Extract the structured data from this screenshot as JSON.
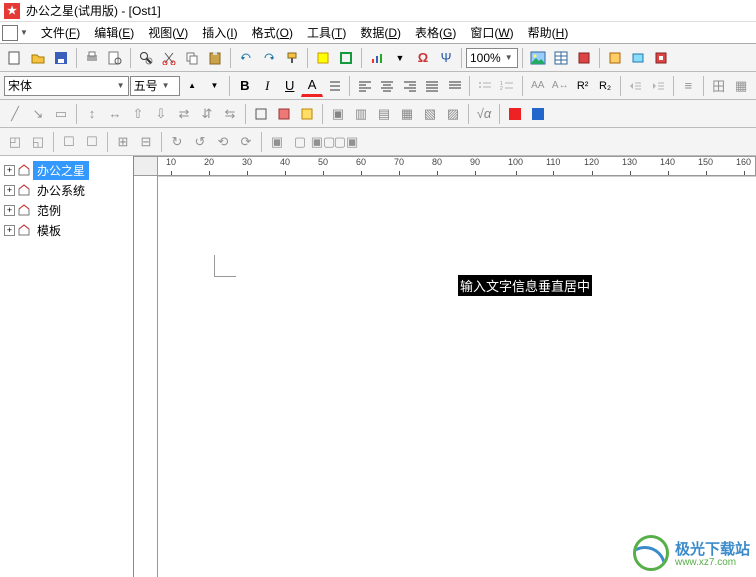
{
  "title": "办公之星(试用版) - [Ost1]",
  "menus": [
    {
      "label": "文件",
      "hotkey": "F"
    },
    {
      "label": "编辑",
      "hotkey": "E"
    },
    {
      "label": "视图",
      "hotkey": "V"
    },
    {
      "label": "插入",
      "hotkey": "I"
    },
    {
      "label": "格式",
      "hotkey": "O"
    },
    {
      "label": "工具",
      "hotkey": "T"
    },
    {
      "label": "数据",
      "hotkey": "D"
    },
    {
      "label": "表格",
      "hotkey": "G"
    },
    {
      "label": "窗口",
      "hotkey": "W"
    },
    {
      "label": "帮助",
      "hotkey": "H"
    }
  ],
  "font": {
    "family": "宋体",
    "size": "五号"
  },
  "zoom": "100%",
  "format_buttons": {
    "bold": "B",
    "italic": "I",
    "underline": "U",
    "font_a": "A"
  },
  "script_buttons": {
    "aa": "AA",
    "sup": "R²",
    "sub": "R₂"
  },
  "tree": [
    {
      "label": "办公之星",
      "selected": true
    },
    {
      "label": "办公系统",
      "selected": false
    },
    {
      "label": "范例",
      "selected": false
    },
    {
      "label": "模板",
      "selected": false
    }
  ],
  "ruler_ticks": [
    10,
    20,
    30,
    40,
    50,
    60,
    70,
    80,
    90,
    100,
    110,
    120,
    130,
    140,
    150,
    160
  ],
  "selected_text": "输入文字信息垂直居中",
  "watermark": {
    "name": "极光下载站",
    "url": "www.xz7.com"
  }
}
